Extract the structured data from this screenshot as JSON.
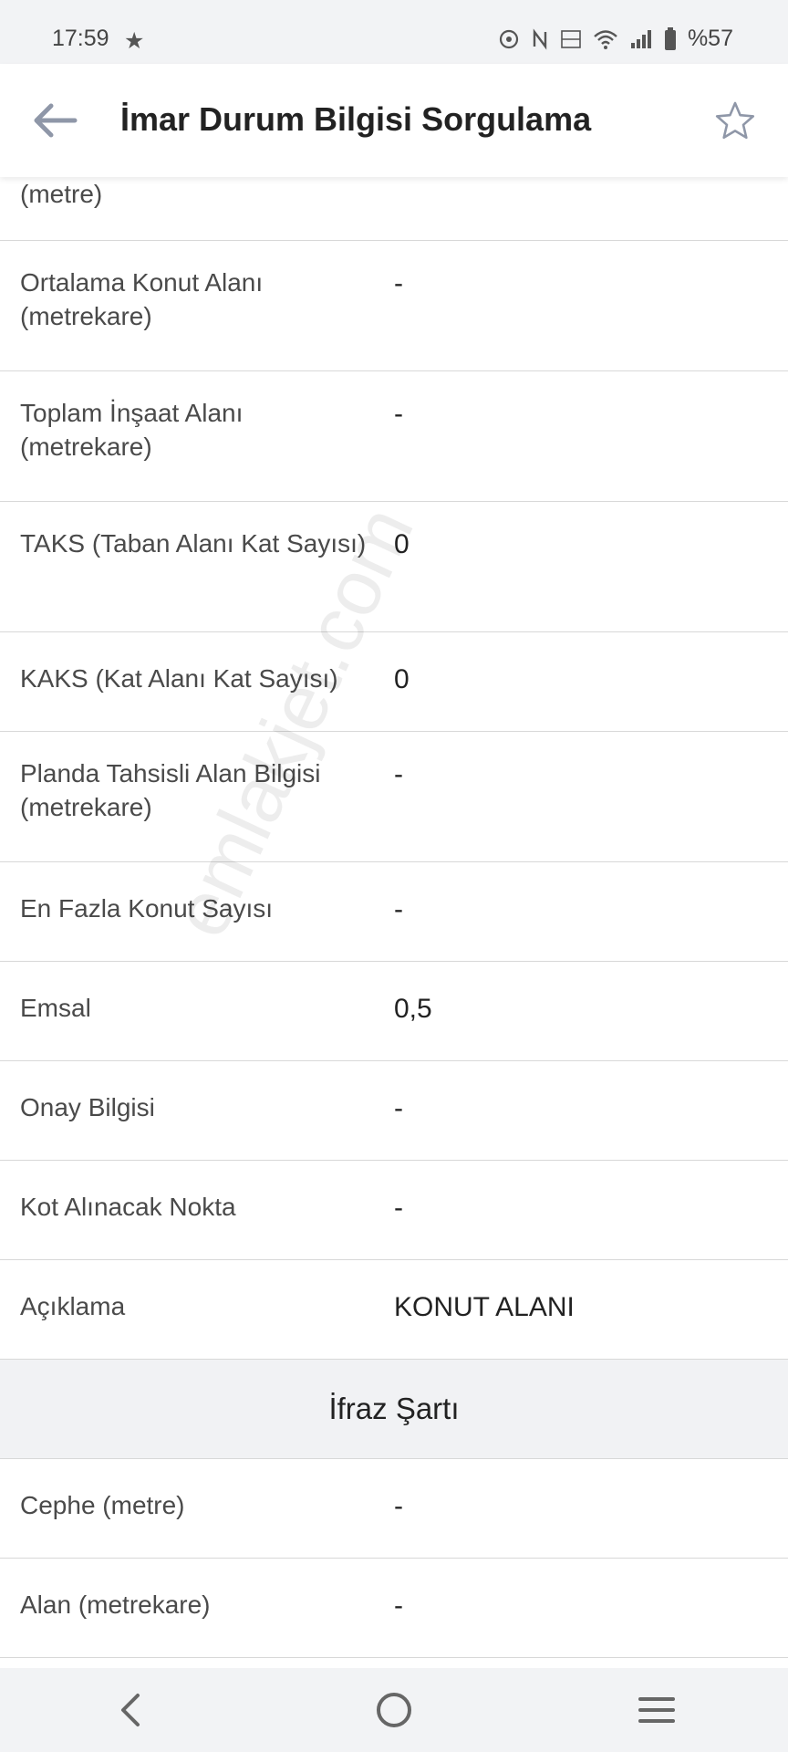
{
  "status_bar": {
    "time": "17:59",
    "star": "★",
    "battery": "%57"
  },
  "app_bar": {
    "title": "İmar Durum Bilgisi Sorgulama"
  },
  "partial_row": {
    "label": "(metre)"
  },
  "rows": [
    {
      "label": "Ortalama Konut Alanı (metrekare)",
      "value": "-"
    },
    {
      "label": "Toplam İnşaat Alanı (metrekare)",
      "value": "-"
    },
    {
      "label": "TAKS (Taban Alanı Kat Sayısı)",
      "value": "0"
    },
    {
      "label": "KAKS (Kat Alanı Kat Sayısı)",
      "value": "0"
    },
    {
      "label": "Planda Tahsisli Alan Bilgisi (metrekare)",
      "value": "-"
    },
    {
      "label": "En Fazla Konut Sayısı",
      "value": "-"
    },
    {
      "label": "Emsal",
      "value": "0,5"
    },
    {
      "label": "Onay Bilgisi",
      "value": "-"
    },
    {
      "label": "Kot Alınacak Nokta",
      "value": "-"
    },
    {
      "label": "Açıklama",
      "value": "KONUT ALANI"
    }
  ],
  "section": {
    "title": "İfraz Şartı"
  },
  "section_rows": [
    {
      "label": "Cephe (metre)",
      "value": "-"
    },
    {
      "label": "Alan (metrekare)",
      "value": "-"
    }
  ],
  "watermark": "emlakjet.com"
}
